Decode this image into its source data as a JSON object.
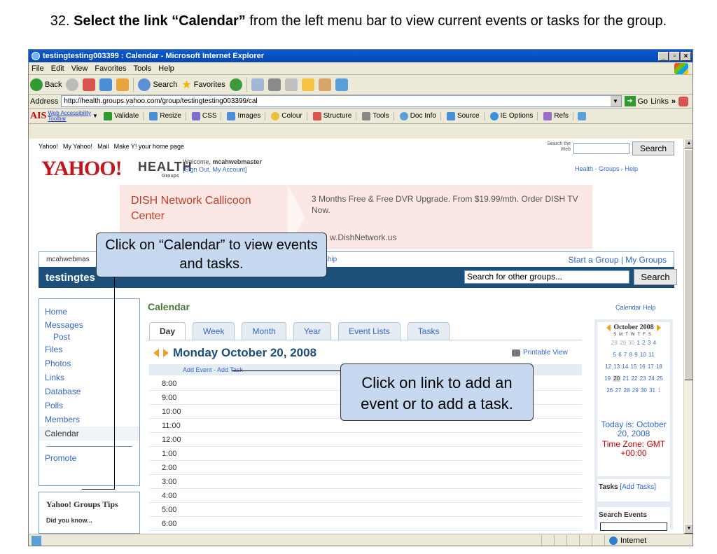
{
  "slide": {
    "title_number": "32.",
    "title_bold": "Select the link “Calendar”",
    "title_rest": "from the left menu bar to view current events or tasks for the group."
  },
  "window": {
    "title": "testingtesting003399 : Calendar - Microsoft Internet Explorer",
    "buttons": [
      "_",
      "▫",
      "×"
    ]
  },
  "menu": [
    "File",
    "Edit",
    "View",
    "Favorites",
    "Tools",
    "Help"
  ],
  "toolbar": {
    "back": "Back",
    "search": "Search",
    "favorites": "Favorites"
  },
  "address": {
    "label": "Address",
    "url": "http://health.groups.yahoo.com/group/testingtesting003399/cal",
    "go": "Go",
    "links": "Links"
  },
  "ais": {
    "logo": "AIS",
    "link": "Web Accessibility",
    "link2": "Toolbar",
    "items": [
      "Validate",
      "Resize",
      "CSS",
      "Images",
      "Colour",
      "Structure",
      "Tools",
      "Doc Info",
      "Source",
      "IE Options",
      "Refs"
    ]
  },
  "yahoo": {
    "top_links": [
      "Yahoo!",
      "My Yahoo!",
      "Mail",
      "Make Y! your home page"
    ],
    "search_label": "Search the Web",
    "search_button": "Search",
    "logo": "YAHOO!",
    "health": "HEALTH",
    "groups_small": "Groups",
    "welcome": "Welcome,",
    "username": "mcahwebmaster",
    "signout": "[Sign Out, My Account]",
    "nav_links": "Health - Groups - Help"
  },
  "ad": {
    "title": "DISH Network Callicoon Center",
    "text": "3 Months Free & Free DVR Upgrade. From $19.99/mth. Order DISH TV Now.",
    "url": "w.DishNetwork.us"
  },
  "group": {
    "user": "mcahwebmas",
    "ownership": "ership",
    "right_links": "Start a Group | My Groups",
    "name": "testingtes",
    "search_placeholder": "Search for other groups...",
    "search_button": "Search"
  },
  "sidebar": {
    "items": [
      {
        "label": "Home"
      },
      {
        "label": "Messages"
      },
      {
        "label": "Post"
      },
      {
        "label": "Files"
      },
      {
        "label": "Photos"
      },
      {
        "label": "Links"
      },
      {
        "label": "Database"
      },
      {
        "label": "Polls"
      },
      {
        "label": "Members"
      },
      {
        "label": "Calendar"
      }
    ],
    "promote": "Promote",
    "tips_title": "Yahoo! Groups Tips",
    "tips_sub": "Did you know..."
  },
  "calendar": {
    "title": "Calendar",
    "help": "Calendar Help",
    "tabs": [
      "Day",
      "Week",
      "Month",
      "Year",
      "Event Lists",
      "Tasks"
    ],
    "day_title": "Monday October 20, 2008",
    "printable": "Printable View",
    "add_links": "Add Event - Add Task",
    "hours": [
      "8:00",
      "9:00",
      "10:00",
      "11:00",
      "12:00",
      "1:00",
      "2:00",
      "3:00",
      "4:00",
      "5:00",
      "6:00"
    ]
  },
  "minical": {
    "month": "October 2008",
    "dow": "SMTWTFS",
    "weeks": [
      [
        "28",
        "29",
        "30",
        "1",
        "2",
        "3",
        "4"
      ],
      [
        "5",
        "6",
        "7",
        "8",
        "9",
        "10",
        "11"
      ],
      [
        "12",
        "13",
        "14",
        "15",
        "16",
        "17",
        "18"
      ],
      [
        "19",
        "20",
        "21",
        "22",
        "23",
        "24",
        "25"
      ],
      [
        "26",
        "27",
        "28",
        "29",
        "30",
        "31",
        "1"
      ]
    ],
    "today": "Today is: October 20, 2008",
    "timezone": "Time Zone: GMT +00:00",
    "tasks_label": "Tasks",
    "add_tasks": "[Add Tasks]",
    "search_events": "Search Events"
  },
  "status": {
    "zone": "Internet"
  },
  "callouts": {
    "calendar": "Click on “Calendar” to view events and tasks.",
    "add": "Click on link to add an event or to add a task."
  }
}
